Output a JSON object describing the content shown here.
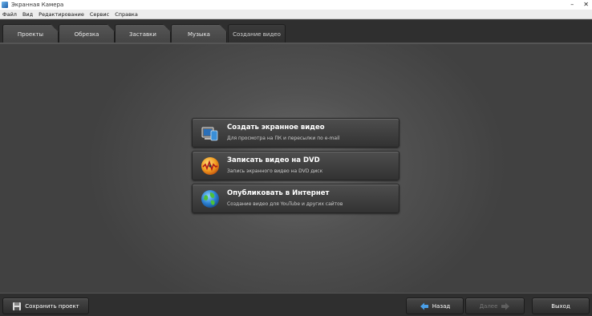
{
  "window": {
    "title": "Экранная Камера",
    "minimize": "–",
    "close": "✕"
  },
  "menu": [
    "Файл",
    "Вид",
    "Редактирование",
    "Сервис",
    "Справка"
  ],
  "tabs": [
    {
      "label": "Проекты",
      "active": false
    },
    {
      "label": "Обрезка",
      "active": false
    },
    {
      "label": "Заставки",
      "active": false
    },
    {
      "label": "Музыка",
      "active": false
    },
    {
      "label": "Создание видео",
      "active": true
    }
  ],
  "options": [
    {
      "title": "Создать экранное видео",
      "description": "Для просмотра на ПК и пересылки по e-mail",
      "icon": "screen-video-icon"
    },
    {
      "title": "Записать видео на DVD",
      "description": "Запись экранного видео на DVD диск",
      "icon": "dvd-disc-icon"
    },
    {
      "title": "Опубликовать в Интернет",
      "description": "Создание видео для YouTube и других сайтов",
      "icon": "globe-icon"
    }
  ],
  "bottom": {
    "save_project": "Сохранить проект",
    "back": "Назад",
    "next": "Далее",
    "exit": "Выход"
  },
  "colors": {
    "accent_arrow": "#4a9fe8",
    "background": "#3c3c3c"
  }
}
